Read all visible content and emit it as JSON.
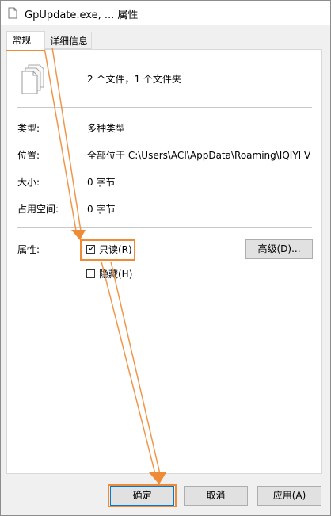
{
  "window": {
    "title": "GpUpdate.exe, ... 属性",
    "title_icon": "document-icon"
  },
  "tabs": [
    {
      "label": "常规",
      "selected": true
    },
    {
      "label": "详细信息",
      "selected": false
    }
  ],
  "general": {
    "icon": "multiple-files-icon",
    "summary": "2 个文件，1 个文件夹",
    "fields": [
      {
        "label": "类型:",
        "value": "多种类型"
      },
      {
        "label": "位置:",
        "value": "全部位于 C:\\Users\\ACI\\AppData\\Roaming\\IQIYI V"
      },
      {
        "label": "大小:",
        "value": "0 字节"
      },
      {
        "label": "占用空间:",
        "value": "0 字节"
      }
    ],
    "attributes_label": "属性:",
    "readonly": {
      "label": "只读(R)",
      "checked": true
    },
    "hidden": {
      "label": "隐藏(H)",
      "checked": false
    },
    "advanced_button": "高级(D)..."
  },
  "footer": {
    "ok": "确定",
    "cancel": "取消",
    "apply": "应用(A)"
  },
  "annotation_color": "#ef8b36"
}
